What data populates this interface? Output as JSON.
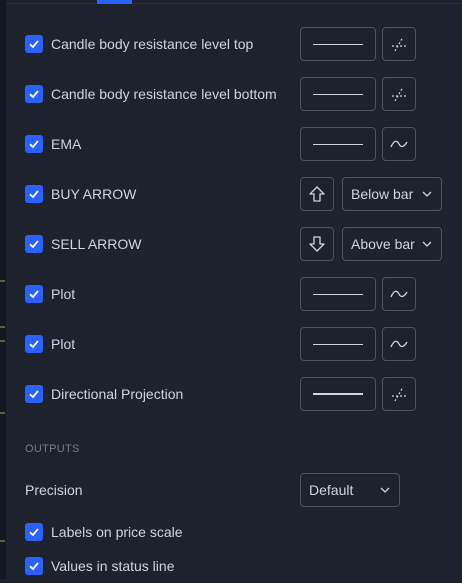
{
  "inputs": [
    {
      "label": "Candle body resistance level top",
      "checked": true,
      "control": "line-dotted"
    },
    {
      "label": "Candle body resistance level bottom",
      "checked": true,
      "control": "line-dotted"
    },
    {
      "label": "EMA",
      "checked": true,
      "control": "line-wave"
    },
    {
      "label": "BUY ARROW",
      "checked": true,
      "control": "arrow-up",
      "location": "Below bar"
    },
    {
      "label": "SELL ARROW",
      "checked": true,
      "control": "arrow-down",
      "location": "Above bar"
    },
    {
      "label": "Plot",
      "checked": true,
      "control": "line-wave"
    },
    {
      "label": "Plot",
      "checked": true,
      "control": "line-wave"
    },
    {
      "label": "Directional Projection",
      "checked": true,
      "control": "line-dotted"
    }
  ],
  "outputs": {
    "section_title": "OUTPUTS",
    "precision_label": "Precision",
    "precision_value": "Default",
    "labels_on_price_scale": "Labels on price scale",
    "values_in_status_line": "Values in status line"
  },
  "colors": {
    "accent": "#2962ff",
    "background": "#1e222d",
    "border": "#50535e",
    "text": "#d1d4dc"
  }
}
